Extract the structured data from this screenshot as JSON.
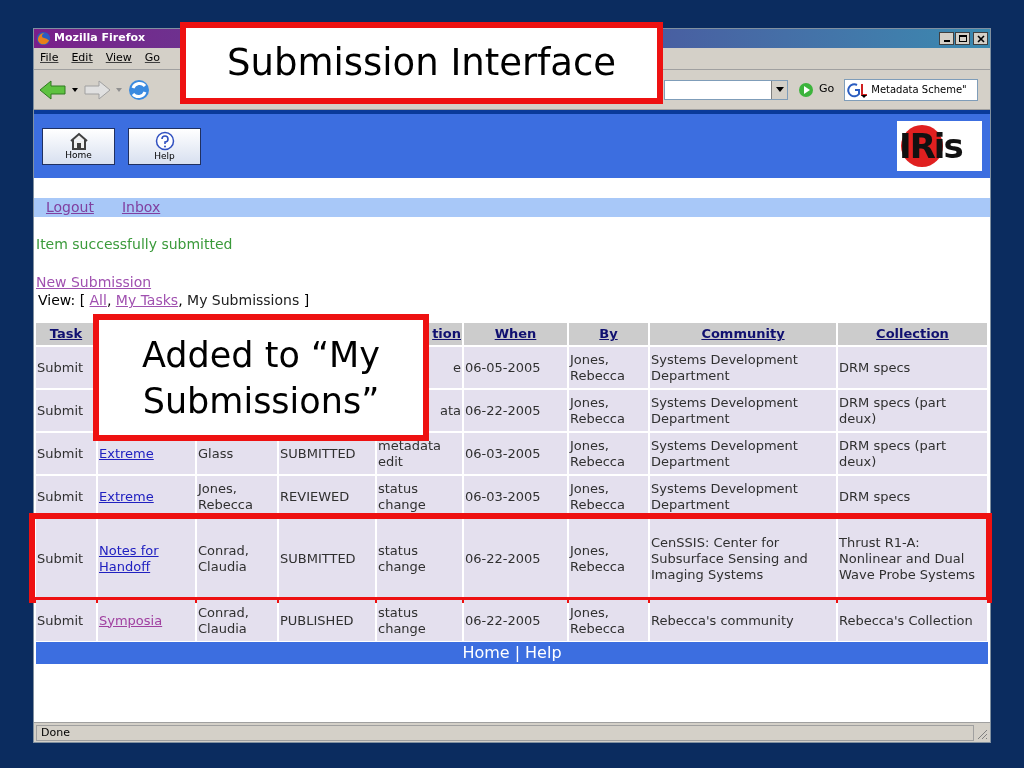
{
  "slide": {
    "title": "Submission Interface",
    "callout": "Added to “My Submissions”"
  },
  "window": {
    "title": "Mozilla Firefox",
    "menus": [
      "File",
      "Edit",
      "View",
      "Go"
    ],
    "go_button": "Go",
    "search_value": "Metadata Scheme\""
  },
  "page": {
    "header_buttons": [
      {
        "kind": "home",
        "label": "Home"
      },
      {
        "kind": "help",
        "label": "Help"
      }
    ],
    "logo": "IRis",
    "nav_links": [
      "Logout",
      "Inbox"
    ],
    "message": "Item successfully submitted",
    "new_submission": "New Submission",
    "view": {
      "label": "View:",
      "open": "[",
      "separator": ",",
      "close": "]",
      "options": [
        {
          "label": "All",
          "selected": false
        },
        {
          "label": "My Tasks",
          "selected": false
        },
        {
          "label": "My Submissions",
          "selected": true
        }
      ]
    },
    "table": {
      "columns": [
        {
          "label": "Task"
        },
        {},
        {},
        {},
        {
          "label": "tion"
        },
        {
          "label": "When"
        },
        {
          "label": "By"
        },
        {
          "label": "Community"
        },
        {
          "label": "Collection"
        }
      ],
      "rows": [
        {
          "highlighted": false,
          "task": "Submit",
          "action": "e",
          "when": "06-05-2005",
          "by": "Jones, Rebecca",
          "community": "Systems Development Department",
          "collection": "DRM specs"
        },
        {
          "highlighted": false,
          "task": "Submit",
          "action": "ata",
          "when": "06-22-2005",
          "by": "Jones, Rebecca",
          "community": "Systems Development Department",
          "collection": "DRM specs (part deux)"
        },
        {
          "highlighted": false,
          "task": "Submit",
          "item": "Extreme",
          "visited": false,
          "submitter": "Glass",
          "status": "SUBMITTED",
          "action": "metadata edit",
          "when": "06-03-2005",
          "by": "Jones, Rebecca",
          "community": "Systems Development Department",
          "collection": "DRM specs (part deux)"
        },
        {
          "highlighted": false,
          "task": "Submit",
          "item": "Extreme",
          "visited": false,
          "submitter": "Jones, Rebecca",
          "status": "REVIEWED",
          "action": "status change",
          "when": "06-03-2005",
          "by": "Jones, Rebecca",
          "community": "Systems Development Department",
          "collection": "DRM specs"
        },
        {
          "highlighted": true,
          "task": "Submit",
          "item": "Notes for Handoff",
          "visited": false,
          "submitter": "Conrad, Claudia",
          "status": "SUBMITTED",
          "action": "status change",
          "when": "06-22-2005",
          "by": "Jones, Rebecca",
          "community": "CenSSIS: Center for Subsurface Sensing and Imaging Systems",
          "collection": "Thrust R1-A: Nonlinear and Dual Wave Probe Systems"
        },
        {
          "highlighted": false,
          "task": "Submit",
          "item": "Symposia",
          "visited": true,
          "submitter": "Conrad, Claudia",
          "status": "PUBLISHED",
          "action": "status change",
          "when": "06-22-2005",
          "by": "Jones, Rebecca",
          "community": "Rebecca's community",
          "collection": "Rebecca's Collection"
        }
      ]
    },
    "footer": {
      "links": [
        "Home",
        "Help"
      ],
      "separator": "|"
    }
  },
  "status_bar": "Done"
}
